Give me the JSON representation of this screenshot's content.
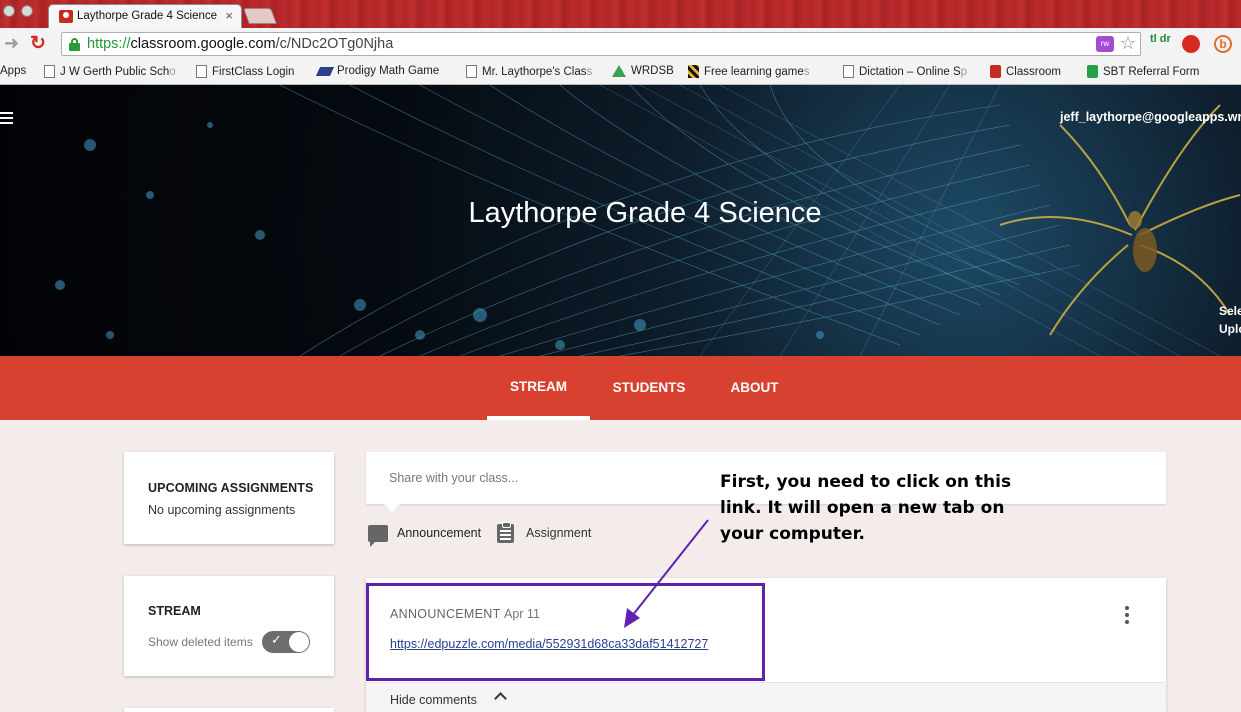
{
  "browser": {
    "tab_title": "Laythorpe Grade 4 Science",
    "tab_close": "×",
    "url_scheme": "https://",
    "url_host": "classroom.google.com",
    "url_path": "/c/NDc2OTg0Njha",
    "extensions": {
      "tldr_label": "tl dr",
      "b_label": "b",
      "puzzle_label": "rw"
    },
    "icons": [
      "forward-icon",
      "reload-icon",
      "lock-icon",
      "puzzle-extension-icon",
      "star-icon",
      "tldr-extension-icon",
      "stop-extension-icon",
      "b-extension-icon"
    ]
  },
  "bookmarks": [
    {
      "label": "Apps",
      "faded": "",
      "icon": "apps-icon"
    },
    {
      "label": "J W Gerth Public Sch",
      "faded": "o",
      "icon": "page-icon"
    },
    {
      "label": "FirstClass Login",
      "faded": "",
      "icon": "page-icon"
    },
    {
      "label": "Prodigy Math Game",
      "faded": "",
      "icon": "prodigy-icon"
    },
    {
      "label": "Mr. Laythorpe's Clas",
      "faded": "s",
      "icon": "page-icon"
    },
    {
      "label": "WRDSB",
      "faded": "",
      "icon": "triangle-icon"
    },
    {
      "label": "Free learning game",
      "faded": "s",
      "icon": "game-icon"
    },
    {
      "label": "Dictation – Online S",
      "faded": "p",
      "icon": "page-icon"
    },
    {
      "label": "Classroom",
      "faded": "",
      "icon": "classroom-icon"
    },
    {
      "label": "SBT Referral Form",
      "faded": "",
      "icon": "form-icon"
    }
  ],
  "classroom": {
    "user_email": "jeff_laythorpe@googleapps.wrd",
    "class_title": "Laythorpe Grade 4 Science",
    "banner_select": "Sele",
    "banner_upload": "Uplo",
    "tabs": [
      {
        "label": "STREAM",
        "active": true
      },
      {
        "label": "STUDENTS",
        "active": false
      },
      {
        "label": "ABOUT",
        "active": false
      }
    ],
    "upcoming": {
      "title": "UPCOMING ASSIGNMENTS",
      "empty_text": "No upcoming assignments"
    },
    "stream_settings": {
      "title": "STREAM",
      "show_deleted_label": "Show deleted items",
      "show_deleted_on": true
    },
    "share": {
      "placeholder": "Share with your class...",
      "announcement_label": "Announcement",
      "assignment_label": "Assignment"
    },
    "post": {
      "type": "ANNOUNCEMENT",
      "date": "Apr 11",
      "link": "https://edpuzzle.com/media/552931d68ca33daf51412727",
      "hide_comments_label": "Hide comments"
    }
  },
  "annotation": {
    "callout_text": "First, you need to click on this link. It will open a new tab on your computer.",
    "highlight_color": "#5e21b0"
  },
  "colors": {
    "brand_red": "#d8412f",
    "link_blue": "#2c3f8f",
    "secure_green": "#229a34"
  }
}
